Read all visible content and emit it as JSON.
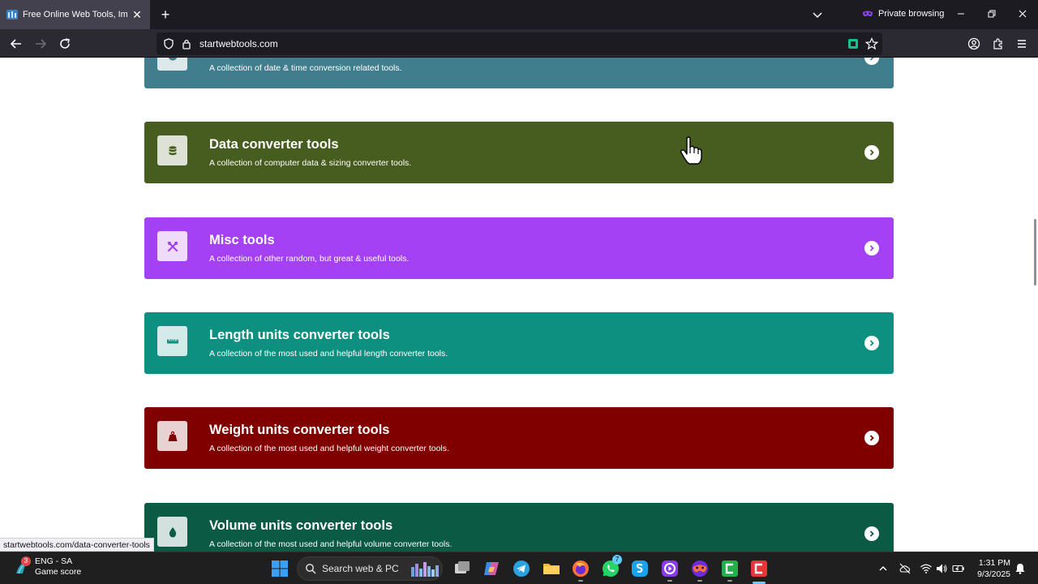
{
  "browser": {
    "tab_title": "Free Online Web Tools, Image Editing, Converters",
    "tab_close": "✕",
    "new_tab": "+",
    "private_label": "Private browsing",
    "url": "startwebtools.com",
    "status_url": "startwebtools.com/data-converter-tools"
  },
  "cards": [
    {
      "title": "",
      "desc": "A collection of date & time conversion related tools.",
      "color": "#417e8d",
      "icon": "clock-icon"
    },
    {
      "title": "Data converter tools",
      "desc": "A collection of computer data & sizing converter tools.",
      "color": "#475d1f",
      "icon": "database-icon"
    },
    {
      "title": "Misc tools",
      "desc": "A collection of other random, but great & useful tools.",
      "color": "#a541f4",
      "icon": "wrench-screwdriver-icon"
    },
    {
      "title": "Length units converter tools",
      "desc": "A collection of the most used and helpful length converter tools.",
      "color": "#0e9080",
      "icon": "ruler-icon"
    },
    {
      "title": "Weight units converter tools",
      "desc": "A collection of the most used and helpful weight converter tools.",
      "color": "#800000",
      "icon": "weight-icon"
    },
    {
      "title": "Volume units converter tools",
      "desc": "A collection of the most used and helpful volume converter tools.",
      "color": "#0a5a44",
      "icon": "droplet-icon"
    }
  ],
  "taskbar": {
    "weather_badge": "3",
    "weather_line1": "ENG - SA",
    "weather_line2": "Game score",
    "search_placeholder": "Search web & PC",
    "whatsapp_badge": "7",
    "time": "1:31 PM",
    "date": "9/3/2025"
  }
}
